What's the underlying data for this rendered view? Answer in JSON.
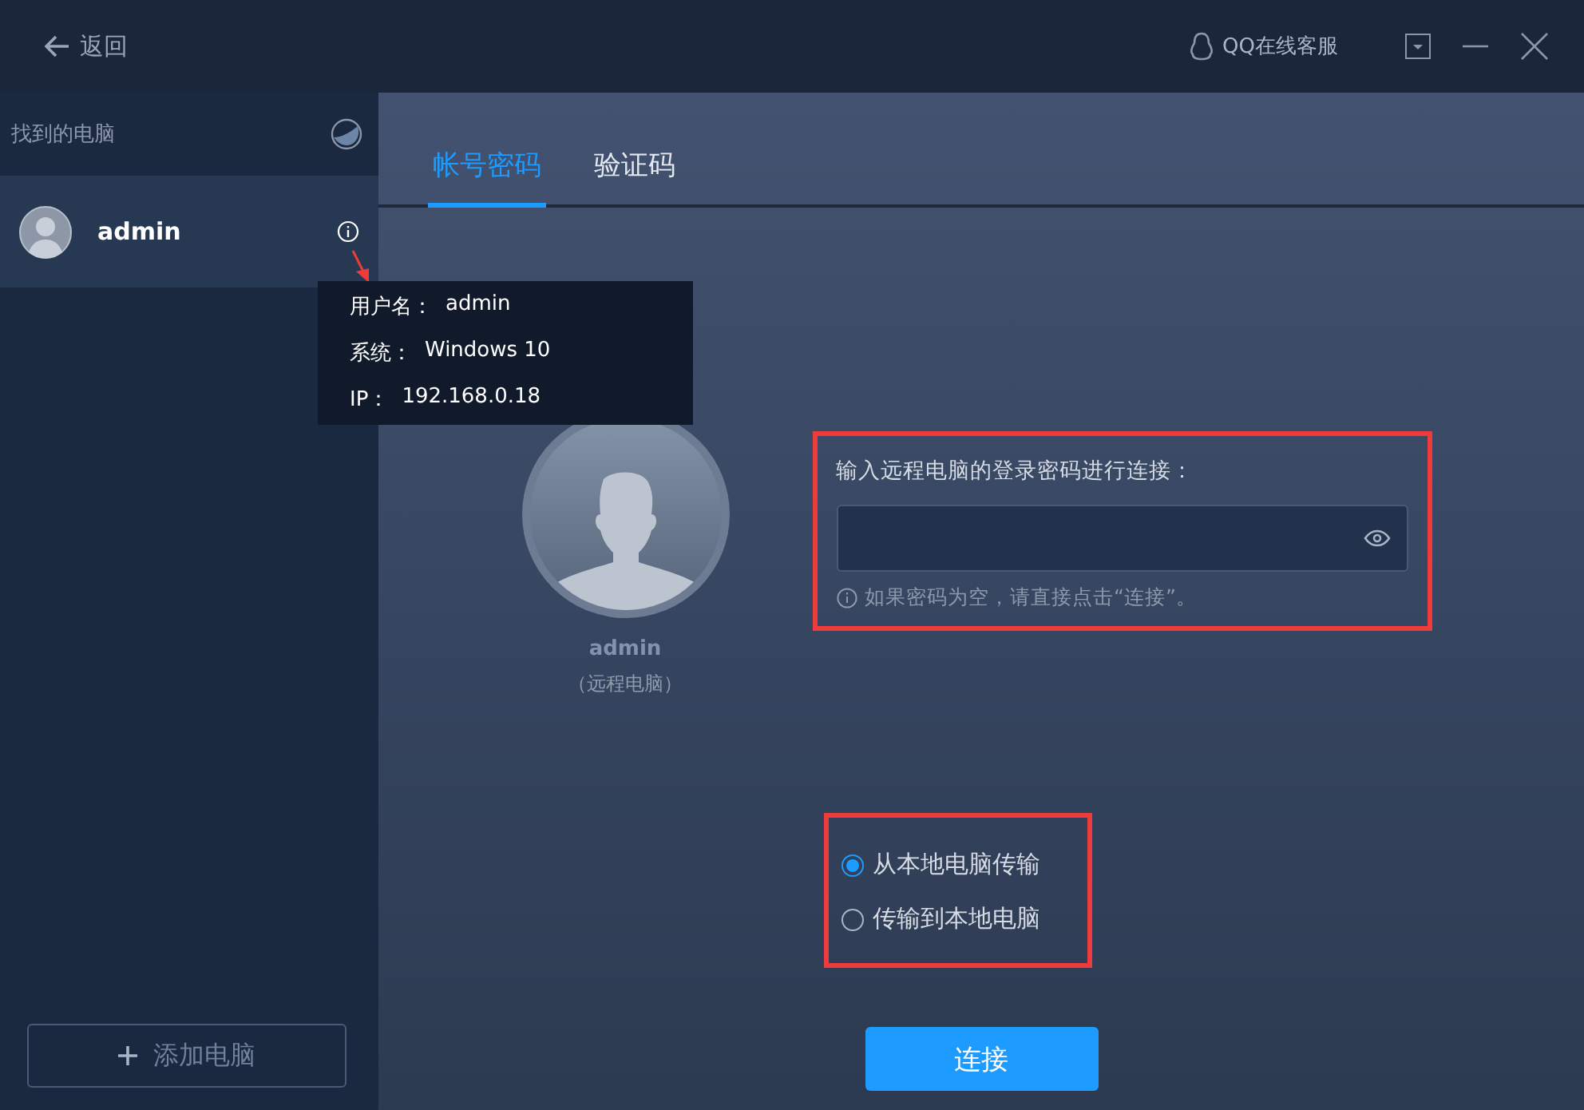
{
  "titlebar": {
    "back_label": "返回",
    "support_label": "QQ在线客服"
  },
  "sidebar": {
    "title": "找到的电脑",
    "computers": [
      {
        "name": "admin",
        "selected": true
      }
    ],
    "add_button": "添加电脑"
  },
  "tooltip": {
    "lines": [
      {
        "label": "用户名：",
        "value": "admin"
      },
      {
        "label": "系统：",
        "value": "Windows 10"
      },
      {
        "label": "IP：",
        "value": "192.168.0.18"
      }
    ]
  },
  "tabs": [
    {
      "label": "帐号密码",
      "selected": true
    },
    {
      "label": "验证码",
      "selected": false
    }
  ],
  "remote": {
    "name": "admin",
    "caption": "（远程电脑）"
  },
  "password": {
    "label": "输入远程电脑的登录密码进行连接：",
    "hint": "如果密码为空，请直接点击“连接”。"
  },
  "direction": [
    {
      "label": "从本地电脑传输",
      "selected": true
    },
    {
      "label": "传输到本地电脑",
      "selected": false
    }
  ],
  "connect_button": "连接"
}
